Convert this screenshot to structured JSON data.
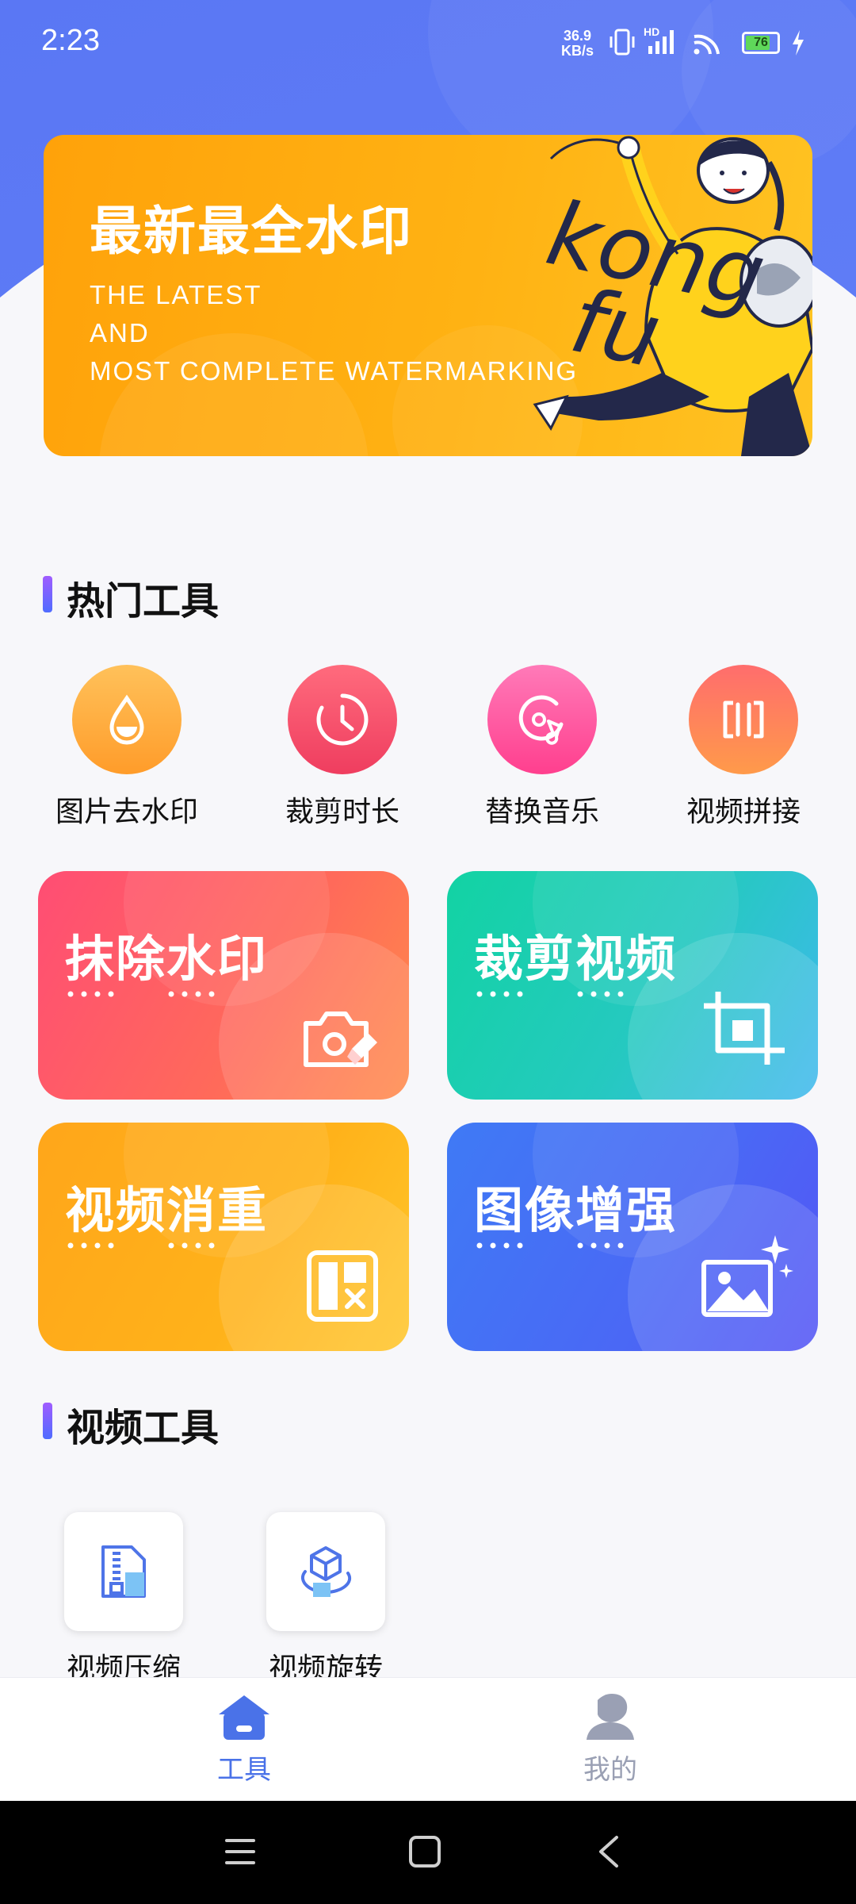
{
  "status_bar": {
    "time": "2:23",
    "net_rate_value": "36.9",
    "net_rate_unit": "KB/s",
    "hd_label": "HD",
    "battery_level": "76"
  },
  "banner": {
    "title": "最新最全水印",
    "subtitle_lines": [
      "THE LATEST",
      "AND",
      "MOST COMPLETE WATERMARKING"
    ],
    "art_text_1": "kong",
    "art_text_2": "fu"
  },
  "hot_tools": {
    "heading": "热门工具",
    "items": [
      {
        "label": "图片去水印",
        "icon": "water-drop-icon"
      },
      {
        "label": "裁剪时长",
        "icon": "clock-icon"
      },
      {
        "label": "替换音乐",
        "icon": "music-disc-icon"
      },
      {
        "label": "视频拼接",
        "icon": "splice-icon"
      }
    ]
  },
  "feature_cards": [
    {
      "title": "抹除水印",
      "icon": "camera-eraser-icon"
    },
    {
      "title": "裁剪视频",
      "icon": "crop-icon"
    },
    {
      "title": "视频消重",
      "icon": "layout-remove-icon"
    },
    {
      "title": "图像增强",
      "icon": "image-sparkle-icon"
    }
  ],
  "video_tools": {
    "heading": "视频工具",
    "items": [
      {
        "label": "视频压缩",
        "icon": "compress-file-icon"
      },
      {
        "label": "视频旋转",
        "icon": "rotate-cube-icon"
      }
    ]
  },
  "tab_bar": {
    "tabs": [
      {
        "label": "工具",
        "icon": "home-icon",
        "active": true
      },
      {
        "label": "我的",
        "icon": "profile-icon",
        "active": false
      }
    ]
  },
  "colors": {
    "header_blue": "#5b78f5",
    "active_tab": "#4a72e8",
    "inactive_tab": "#9aa0b4"
  }
}
